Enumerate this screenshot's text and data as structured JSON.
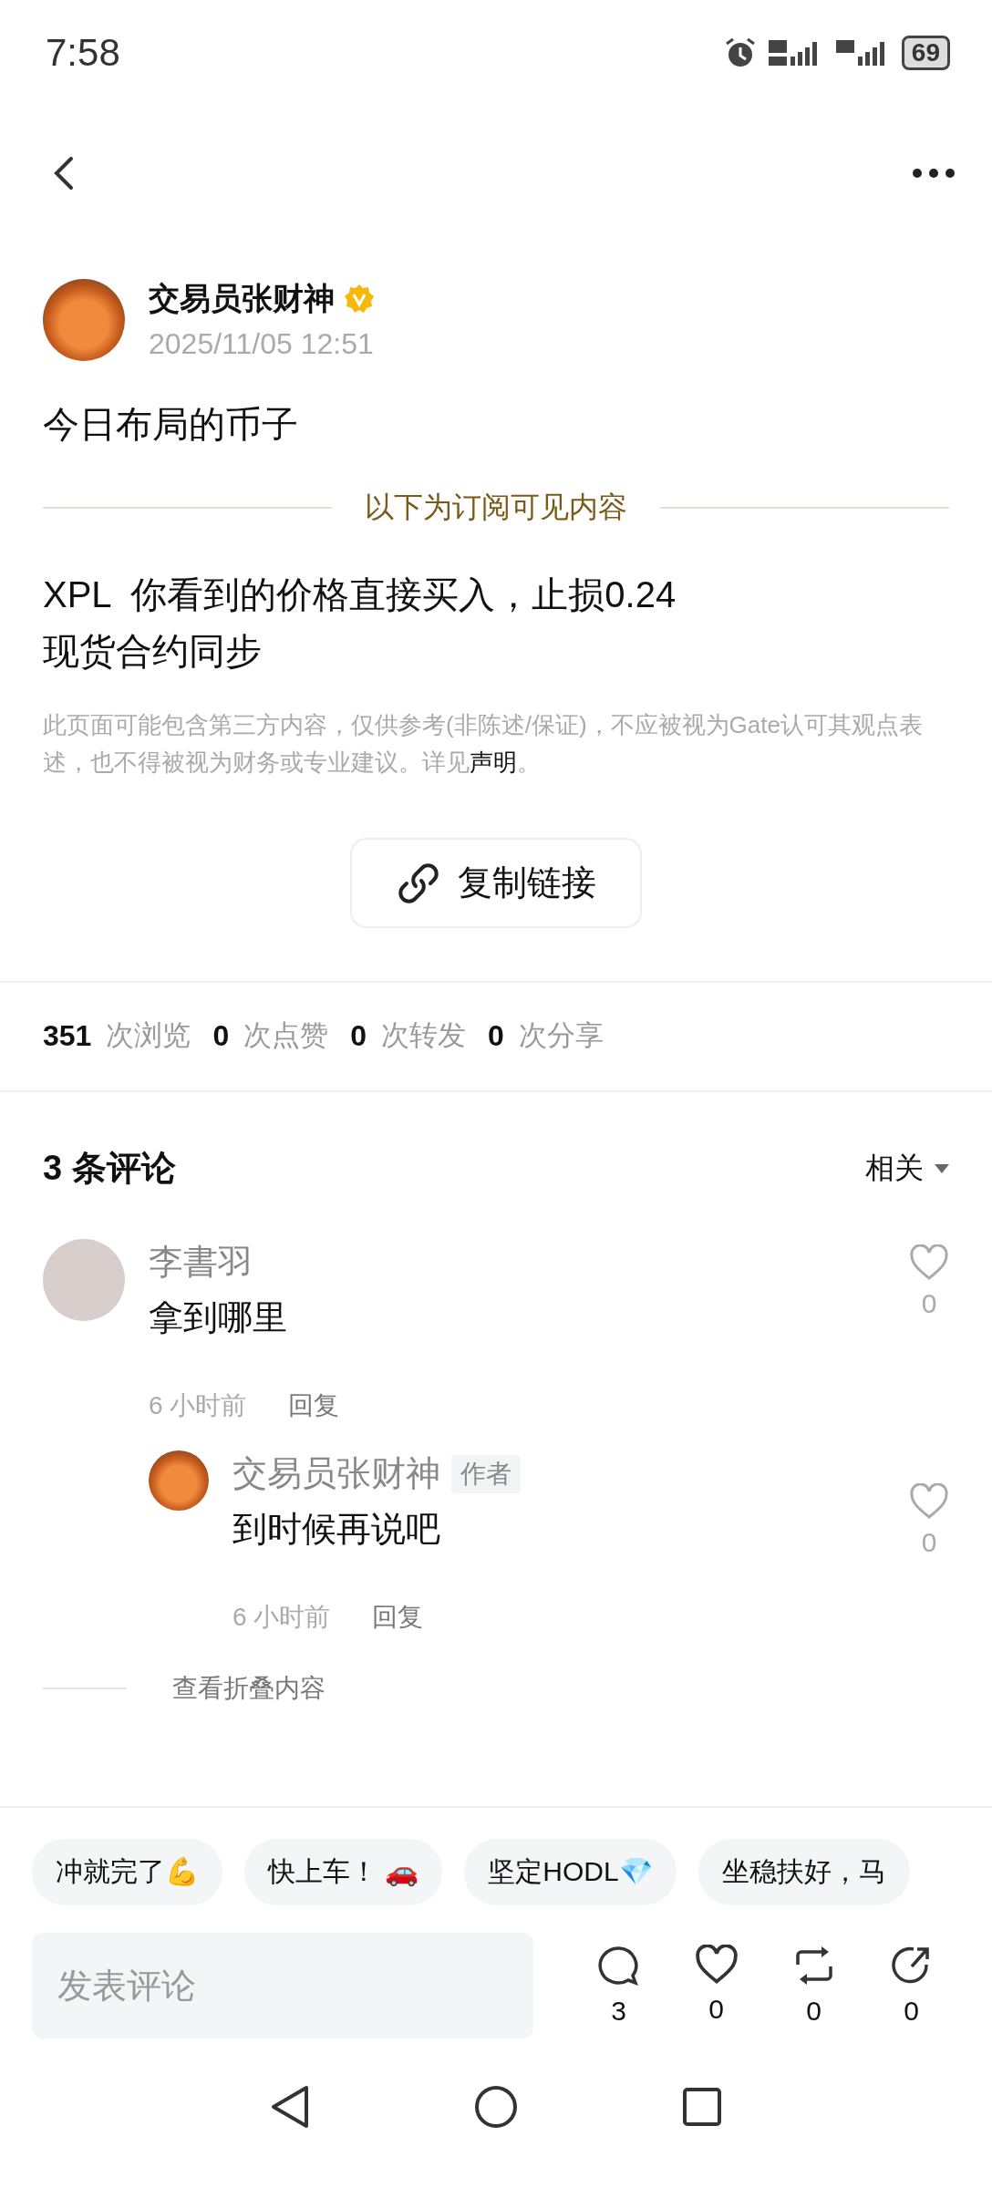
{
  "status_bar": {
    "time": "7:58",
    "battery": "69"
  },
  "post": {
    "author": "交易员张财神",
    "verified": true,
    "date": "2025/11/05 12:51",
    "title": "今日布局的币子",
    "divider_label": "以下为订阅可见内容",
    "body_lines": [
      "XPL  你看到的价格直接买入，止损0.24",
      "现货合约同步"
    ],
    "disclaimer": "此页面可能包含第三方内容，仅供参考(非陈述/保证)，不应被视为Gate认可其观点表述，也不得被视为财务或专业建议。详见",
    "disclaimer_link": "声明",
    "disclaimer_end": "。",
    "copy_button": "复制链接"
  },
  "stats": [
    {
      "count": "351",
      "label": "次浏览"
    },
    {
      "count": "0",
      "label": "次点赞"
    },
    {
      "count": "0",
      "label": "次转发"
    },
    {
      "count": "0",
      "label": "次分享"
    }
  ],
  "comments": {
    "title": "3 条评论",
    "sort": "相关",
    "items": [
      {
        "author": "李書羽",
        "kind": "photo",
        "text": "拿到哪里",
        "time": "6 小时前",
        "reply": "回复",
        "likes": "0",
        "children": [
          {
            "author": "交易员张财神",
            "kind": "fox",
            "badge": "作者",
            "text": "到时候再说吧",
            "time": "6 小时前",
            "reply": "回复",
            "likes": "0"
          }
        ]
      }
    ],
    "fold_link": "查看折叠内容"
  },
  "quick_replies": [
    "冲就完了💪",
    "快上车！ 🚗",
    "坚定HODL💎",
    "坐稳扶好，马"
  ],
  "composer": {
    "placeholder": "发表评论"
  },
  "actions": [
    {
      "kind": "comment",
      "count": "3"
    },
    {
      "kind": "like",
      "count": "0"
    },
    {
      "kind": "repost",
      "count": "0"
    },
    {
      "kind": "share",
      "count": "0"
    }
  ]
}
